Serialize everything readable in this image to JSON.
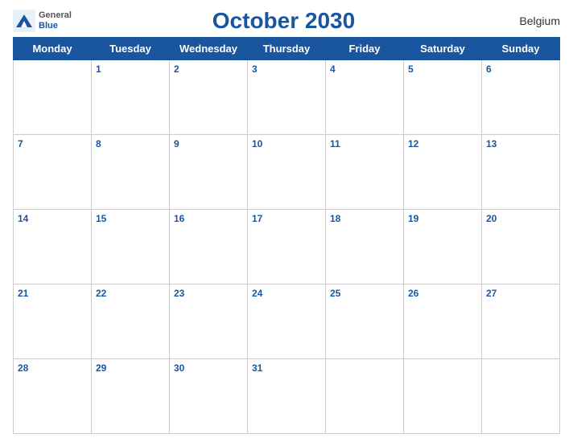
{
  "header": {
    "title": "October 2030",
    "country": "Belgium",
    "logo_general": "General",
    "logo_blue": "Blue"
  },
  "days_of_week": [
    "Monday",
    "Tuesday",
    "Wednesday",
    "Thursday",
    "Friday",
    "Saturday",
    "Sunday"
  ],
  "weeks": [
    [
      null,
      1,
      2,
      3,
      4,
      5,
      6
    ],
    [
      7,
      8,
      9,
      10,
      11,
      12,
      13
    ],
    [
      14,
      15,
      16,
      17,
      18,
      19,
      20
    ],
    [
      21,
      22,
      23,
      24,
      25,
      26,
      27
    ],
    [
      28,
      29,
      30,
      31,
      null,
      null,
      null
    ]
  ]
}
